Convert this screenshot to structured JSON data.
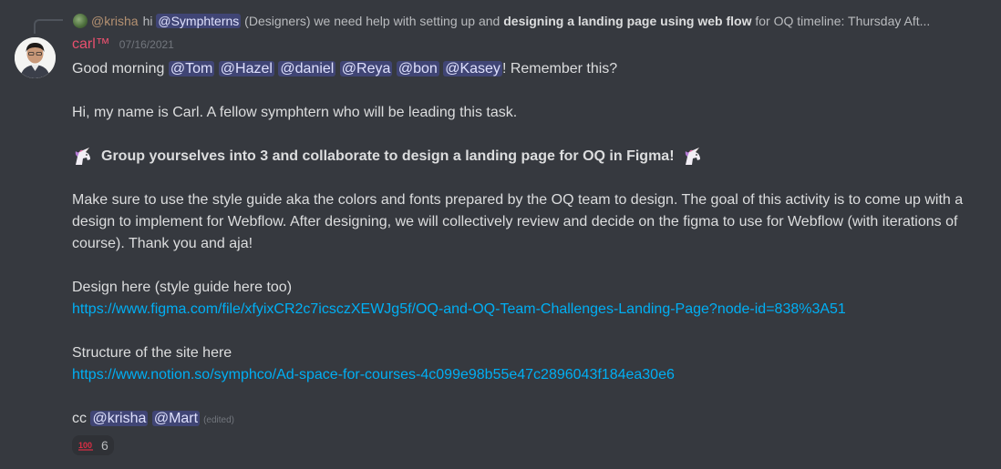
{
  "reply": {
    "author": "@krisha",
    "text_before": "hi ",
    "mention": "@Symphterns",
    "text_middle": " (Designers) we need help with setting up and ",
    "bold_text": "designing a landing page using web flow",
    "text_after": " for OQ   timeline: Thursday Aft..."
  },
  "message": {
    "username": "carl™",
    "timestamp": "07/16/2021",
    "line1_prefix": "Good morning ",
    "line1_mentions": [
      "@Tom",
      "@Hazel",
      "@daniel",
      "@Reya",
      "@bon",
      "@Kasey"
    ],
    "line1_suffix": "! Remember this?",
    "intro": "Hi, my name is Carl. A fellow symphtern who will be leading this task.",
    "heading": "Group yourselves into 3 and collaborate to design a landing page for OQ in Figma!",
    "heading_emoji": "unicorn-icon",
    "paragraph": "Make sure to use the style guide aka the colors and fonts prepared by the OQ team to design. The goal of this activity is to come up with a design to implement for Webflow. After designing, we will collectively review and decide on the figma to use for Webflow (with iterations of course). Thank you and aja!",
    "design_label": "Design here (style guide here too)",
    "design_link": "https://www.figma.com/file/xfyixCR2c7icsczXEWJg5f/OQ-and-OQ-Team-Challenges-Landing-Page?node-id=838%3A51",
    "structure_label": "Structure of the site here",
    "structure_link": "https://www.notion.so/symphco/Ad-space-for-courses-4c099e98b55e47c2896043f184ea30e6",
    "cc_prefix": "cc ",
    "cc_mentions": [
      "@krisha",
      "@Mart"
    ],
    "edited": "(edited)"
  },
  "reaction": {
    "emoji": "fire-100-icon",
    "count": "6"
  },
  "colors": {
    "background": "#36393f",
    "username": "#e8506e",
    "link": "#00aff4",
    "mention_bg": "rgba(88,101,242,0.3)"
  }
}
